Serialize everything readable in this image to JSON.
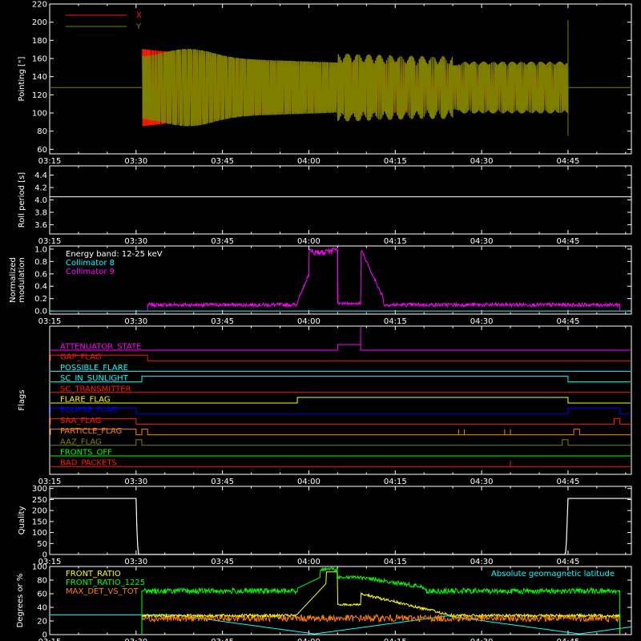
{
  "colors": {
    "background": "#000000",
    "axes": "#ffffff",
    "x_red": "#ff1a00",
    "y_olive": "#808000",
    "cyan": "#00ffff",
    "magenta": "#ff00ff",
    "yellow": "#ffff00",
    "green": "#00ff00",
    "orange": "#ff8000",
    "blue": "#0000ff"
  },
  "chart_data": [
    {
      "panel": "pointing",
      "type": "line",
      "ylabel": "Pointing [\"]",
      "ylim": [
        55,
        220
      ],
      "yticks": [
        60,
        80,
        100,
        120,
        140,
        160,
        180,
        200,
        220
      ],
      "time_ticks": [
        "03:15",
        "03:30",
        "03:45",
        "04:00",
        "04:15",
        "04:30",
        "04:45"
      ],
      "series": [
        {
          "name": "X",
          "color": "#ff1a00",
          "center": 128,
          "start": "03:31",
          "end": "04:45",
          "amplitude_start": 42,
          "amplitude_mid": 20
        },
        {
          "name": "Y",
          "color": "#808000",
          "center": 128,
          "start": "03:31",
          "end": "04:45",
          "amplitude_start": 32,
          "amplitude_peak": 40
        }
      ],
      "baseline": 128
    },
    {
      "panel": "roll",
      "type": "line",
      "ylabel": "Roll period [s]",
      "ylim": [
        3.45,
        4.55
      ],
      "yticks": [
        3.6,
        3.8,
        4.0,
        4.2,
        4.4
      ],
      "time_ticks": [
        "03:15",
        "03:30",
        "03:45",
        "04:00",
        "04:15",
        "04:30",
        "04:45"
      ],
      "value": 4.05
    },
    {
      "panel": "modulation",
      "type": "line",
      "ylabel": [
        "Normalized",
        "modulation"
      ],
      "ylim": [
        -0.05,
        1.05
      ],
      "yticks": [
        0.0,
        0.2,
        0.4,
        0.6,
        0.8,
        1.0
      ],
      "time_ticks": [
        "03:15",
        "03:30",
        "03:45",
        "04:00",
        "04:15",
        "04:30",
        "04:45"
      ],
      "legend": [
        "Energy band: 12-25 keV",
        "Collimator 8",
        "Collimator 9"
      ],
      "series": [
        {
          "name": "Collimator 8",
          "color": "#00ffff"
        },
        {
          "name": "Collimator 9",
          "color": "#ff00ff",
          "baseline": 0.1,
          "start": "03:32",
          "end": "04:54"
        }
      ]
    },
    {
      "panel": "flags",
      "type": "line",
      "ylabel": "Flags",
      "time_ticks": [
        "03:15",
        "03:30",
        "03:45",
        "04:00",
        "04:15",
        "04:30",
        "04:45"
      ],
      "flags": [
        {
          "name": "ATTENUATOR_STATE",
          "color": "#ff00ff",
          "high_intervals": [
            [
              "04:05",
              "04:09"
            ]
          ],
          "spike": "04:09"
        },
        {
          "name": "GAP_FLAG",
          "color": "#ff1a00",
          "high_intervals": [
            [
              "03:15",
              "03:32"
            ]
          ]
        },
        {
          "name": "POSSIBLE_FLARE",
          "color": "#00ffff",
          "high_intervals": []
        },
        {
          "name": "SC_IN_SUNLIGHT",
          "color": "#00ffff",
          "high_intervals": [
            [
              "03:31",
              "04:45"
            ]
          ]
        },
        {
          "name": "SC_TRANSMITTER",
          "color": "#ff1a00",
          "high_intervals": []
        },
        {
          "name": "FLARE_FLAG",
          "color": "#ffff00",
          "high_intervals": [
            [
              "03:58",
              "04:45"
            ]
          ]
        },
        {
          "name": "ECLIPSE_FLAG",
          "color": "#0000ff",
          "high_intervals": [
            [
              "03:15",
              "03:30"
            ],
            [
              "04:45",
              "04:54"
            ]
          ]
        },
        {
          "name": "SAA_FLAG",
          "color": "#ff1a00",
          "high_intervals": [
            [
              "03:15",
              "03:30"
            ],
            [
              "04:53",
              "04:54"
            ]
          ]
        },
        {
          "name": "PARTICLE_FLAG",
          "color": "#ff8000",
          "high_intervals": [
            [
              "03:15",
              "03:30"
            ],
            [
              "03:31",
              "03:32"
            ],
            [
              "04:46",
              "04:47"
            ]
          ],
          "spikes": [
            "04:26",
            "04:27",
            "04:34",
            "04:35"
          ]
        },
        {
          "name": "AAZ_FLAG",
          "color": "#808000",
          "high_intervals": [
            [
              "03:30",
              "03:31"
            ],
            [
              "04:44",
              "04:45"
            ]
          ]
        },
        {
          "name": "FRONTS_OFF",
          "color": "#00ff00",
          "high_intervals": []
        },
        {
          "name": "BAD_PACKETS",
          "color": "#ff1a00",
          "high_intervals": [],
          "spikes": [
            "04:35"
          ]
        }
      ]
    },
    {
      "panel": "quality",
      "type": "line",
      "ylabel": "Quality",
      "ylim": [
        0,
        310
      ],
      "yticks": [
        0,
        50,
        100,
        150,
        200,
        250,
        300
      ],
      "time_ticks": [
        "03:15",
        "03:30",
        "03:45",
        "04:00",
        "04:15",
        "04:30",
        "04:45"
      ],
      "high_value": 255,
      "low_interval": [
        "03:30",
        "04:45"
      ]
    },
    {
      "panel": "ratios",
      "type": "line",
      "ylabel": "Degrees or %",
      "ylim": [
        0,
        100
      ],
      "yticks": [
        0,
        20,
        40,
        60,
        80,
        100
      ],
      "time_ticks": [
        "03:15",
        "03:30",
        "03:45",
        "04:00",
        "04:15",
        "04:30",
        "04:45"
      ],
      "legend_left": [
        "FRONT_RATIO",
        "FRONT_RATIO_1225",
        "MAX_DET_VS_TOT"
      ],
      "legend_right": "Absolute geomagnetic latitude",
      "series": [
        {
          "name": "FRONT_RATIO",
          "color": "#ffff00"
        },
        {
          "name": "FRONT_RATIO_1225",
          "color": "#00ff00"
        },
        {
          "name": "MAX_DET_VS_TOT",
          "color": "#ff8000"
        },
        {
          "name": "Absolute geomagnetic latitude",
          "color": "#00ffff"
        }
      ]
    }
  ]
}
